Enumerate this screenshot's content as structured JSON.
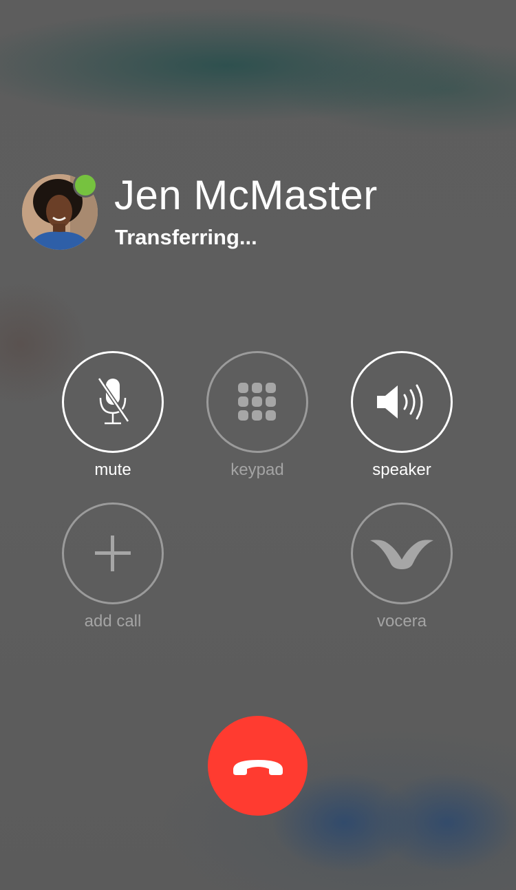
{
  "caller": {
    "name": "Jen McMaster",
    "status": "Transferring...",
    "presence_color": "#76c23f",
    "avatar_icon": "caller-photo"
  },
  "controls": {
    "mute": {
      "label": "mute",
      "icon": "mic-off-icon",
      "enabled": true
    },
    "keypad": {
      "label": "keypad",
      "icon": "keypad-icon",
      "enabled": false
    },
    "speaker": {
      "label": "speaker",
      "icon": "speaker-icon",
      "enabled": true
    },
    "add_call": {
      "label": "add call",
      "icon": "plus-icon",
      "enabled": false
    },
    "vocera": {
      "label": "vocera",
      "icon": "vocera-logo-icon",
      "enabled": false
    }
  },
  "end_call": {
    "icon": "hang-up-icon",
    "color": "#ff3b30"
  }
}
